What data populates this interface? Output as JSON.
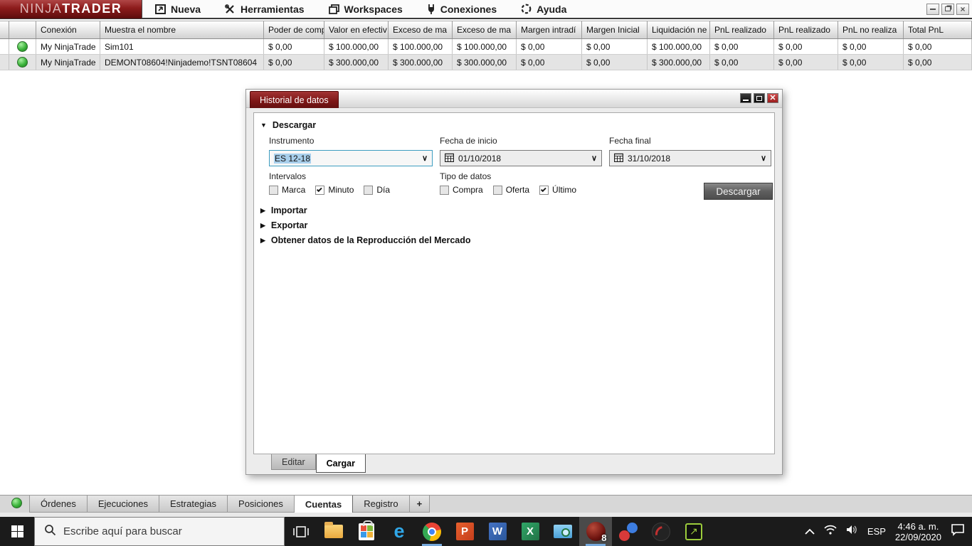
{
  "colors": {
    "brand_red": "#8d1c1c",
    "status_green": "#3cb43c",
    "selection_blue": "#a8cfec",
    "taskbar_bg": "#1b1b1b"
  },
  "window": {
    "logo": {
      "ninja": "NINJA",
      "trader": "TRADER"
    },
    "menus": [
      {
        "label": "Nueva",
        "icon": "new-window-icon"
      },
      {
        "label": "Herramientas",
        "icon": "tools-icon"
      },
      {
        "label": "Workspaces",
        "icon": "workspaces-icon"
      },
      {
        "label": "Conexiones",
        "icon": "plug-icon"
      },
      {
        "label": "Ayuda",
        "icon": "help-icon"
      }
    ]
  },
  "accounts_table": {
    "columns": [
      "Conexión",
      "Muestra el nombre",
      "Poder de comp",
      "Valor en efectiv",
      "Exceso de ma",
      "Exceso de ma",
      "Margen intradí",
      "Margen Inicial",
      "Liquidación ne",
      "PnL realizado",
      "PnL realizado",
      "PnL no realiza",
      "Total PnL"
    ],
    "rows": [
      {
        "status": "connected",
        "cells": [
          "My NinjaTrade",
          "Sim101",
          "$ 0,00",
          "$ 100.000,00",
          "$ 100.000,00",
          "$ 100.000,00",
          "$ 0,00",
          "$ 0,00",
          "$ 100.000,00",
          "$ 0,00",
          "$ 0,00",
          "$ 0,00",
          "$ 0,00"
        ]
      },
      {
        "status": "connected",
        "cells": [
          "My NinjaTrade",
          "DEMONT08604!Ninjademo!TSNT08604",
          "$ 0,00",
          "$ 300.000,00",
          "$ 300.000,00",
          "$ 300.000,00",
          "$ 0,00",
          "$ 0,00",
          "$ 300.000,00",
          "$ 0,00",
          "$ 0,00",
          "$ 0,00",
          "$ 0,00"
        ]
      }
    ]
  },
  "dialog": {
    "title": "Historial de datos",
    "sections": {
      "descargar": "Descargar",
      "importar": "Importar",
      "exportar": "Exportar",
      "obtener": "Obtener datos de la Reproducción del Mercado"
    },
    "fields": {
      "instrumento": {
        "label": "Instrumento",
        "value": "ES 12-18"
      },
      "fecha_inicio": {
        "label": "Fecha de inicio",
        "value": "01/10/2018"
      },
      "fecha_final": {
        "label": "Fecha final",
        "value": "31/10/2018"
      }
    },
    "intervalos": {
      "label": "Intervalos",
      "options": [
        {
          "label": "Marca",
          "checked": false
        },
        {
          "label": "Minuto",
          "checked": true
        },
        {
          "label": "Día",
          "checked": false
        }
      ]
    },
    "tipo_datos": {
      "label": "Tipo de datos",
      "options": [
        {
          "label": "Compra",
          "checked": false
        },
        {
          "label": "Oferta",
          "checked": false
        },
        {
          "label": "Último",
          "checked": true
        }
      ]
    },
    "download_button": "Descargar",
    "tabs": [
      {
        "label": "Editar",
        "active": false
      },
      {
        "label": "Cargar",
        "active": true
      }
    ]
  },
  "bottom_tabs": {
    "items": [
      {
        "label": "Órdenes",
        "active": false
      },
      {
        "label": "Ejecuciones",
        "active": false
      },
      {
        "label": "Estrategias",
        "active": false
      },
      {
        "label": "Posiciones",
        "active": false
      },
      {
        "label": "Cuentas",
        "active": true
      },
      {
        "label": "Registro",
        "active": false
      }
    ],
    "add_label": "+"
  },
  "taskbar": {
    "search_placeholder": "Escribe aquí para buscar",
    "app_icons": [
      "task-view",
      "file-explorer",
      "microsoft-store",
      "edge",
      "chrome",
      "powerpoint",
      "word",
      "excel",
      "snipping-tool",
      "ninjatrader-8",
      "color-dots-app",
      "ninjatrader",
      "screen-share"
    ],
    "glyphs": {
      "edge": "e",
      "powerpoint": "P",
      "word": "W",
      "excel": "X",
      "nt8": "8",
      "share": "↗"
    },
    "language": "ESP",
    "time": "4:46 a. m.",
    "date": "22/09/2020"
  }
}
